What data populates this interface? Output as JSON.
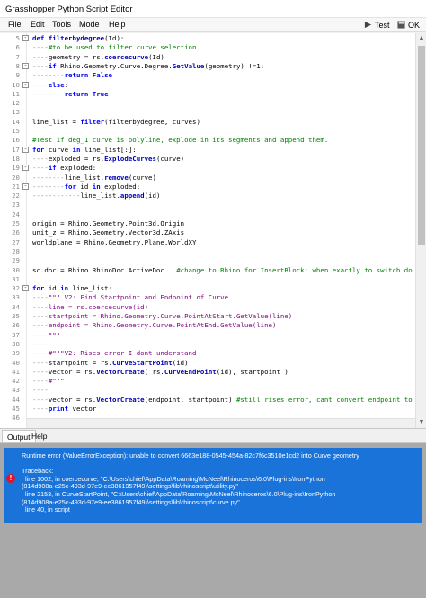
{
  "window": {
    "title": "Grasshopper Python Script Editor"
  },
  "menu": {
    "items": [
      "File",
      "Edit",
      "Tools",
      "Mode",
      "Help"
    ]
  },
  "toolbar": {
    "test_label": "Test",
    "ok_label": "OK"
  },
  "editor": {
    "lines": [
      {
        "n": "5",
        "fold": "-",
        "segs": [
          [
            "k",
            "def "
          ],
          [
            "f",
            "filterbydegree"
          ],
          [
            "p",
            "(Id):"
          ]
        ]
      },
      {
        "n": "6",
        "segs": [
          [
            "i",
            "----"
          ],
          [
            "c",
            "#to be used to filter curve selection."
          ]
        ]
      },
      {
        "n": "7",
        "segs": [
          [
            "i",
            "----"
          ],
          [
            "p",
            "geometry = rs."
          ],
          [
            "f",
            "coercecurve"
          ],
          [
            "p",
            "(Id)"
          ]
        ]
      },
      {
        "n": "8",
        "fold": "-",
        "segs": [
          [
            "i",
            "----"
          ],
          [
            "k",
            "if "
          ],
          [
            "p",
            "Rhino.Geometry.Curve.Degree."
          ],
          [
            "f",
            "GetValue"
          ],
          [
            "p",
            "(geometry) !=1:"
          ]
        ]
      },
      {
        "n": "9",
        "segs": [
          [
            "i",
            "--------"
          ],
          [
            "k",
            "return False"
          ]
        ]
      },
      {
        "n": "10",
        "fold": "-",
        "segs": [
          [
            "i",
            "----"
          ],
          [
            "k",
            "else"
          ],
          [
            "p",
            ":"
          ]
        ]
      },
      {
        "n": "11",
        "segs": [
          [
            "i",
            "--------"
          ],
          [
            "k",
            "return True"
          ]
        ]
      },
      {
        "n": "12",
        "segs": []
      },
      {
        "n": "13",
        "segs": []
      },
      {
        "n": "14",
        "segs": [
          [
            "p",
            "line_list = "
          ],
          [
            "k",
            "filter"
          ],
          [
            "p",
            "(filterbydegree, curves)"
          ]
        ]
      },
      {
        "n": "15",
        "segs": []
      },
      {
        "n": "16",
        "segs": [
          [
            "c",
            "#Test if deg_1 curve is polyline, explode in its segments and append them."
          ]
        ]
      },
      {
        "n": "17",
        "fold": "-",
        "segs": [
          [
            "k",
            "for "
          ],
          [
            "p",
            "curve "
          ],
          [
            "k",
            "in "
          ],
          [
            "p",
            "line_list[:]:"
          ]
        ]
      },
      {
        "n": "18",
        "segs": [
          [
            "i",
            "----"
          ],
          [
            "p",
            "exploded = rs."
          ],
          [
            "f",
            "ExplodeCurves"
          ],
          [
            "p",
            "(curve)"
          ]
        ]
      },
      {
        "n": "19",
        "fold": "-",
        "segs": [
          [
            "i",
            "----"
          ],
          [
            "k",
            "if "
          ],
          [
            "p",
            "exploded:"
          ]
        ]
      },
      {
        "n": "20",
        "segs": [
          [
            "i",
            "--------"
          ],
          [
            "p",
            "line_list."
          ],
          [
            "f",
            "remove"
          ],
          [
            "p",
            "(curve)"
          ]
        ]
      },
      {
        "n": "21",
        "fold": "-",
        "segs": [
          [
            "i",
            "--------"
          ],
          [
            "k",
            "for "
          ],
          [
            "p",
            "id "
          ],
          [
            "k",
            "in "
          ],
          [
            "p",
            "exploded:"
          ]
        ]
      },
      {
        "n": "22",
        "segs": [
          [
            "i",
            "------------"
          ],
          [
            "p",
            "line_list."
          ],
          [
            "f",
            "append"
          ],
          [
            "p",
            "(id)"
          ]
        ]
      },
      {
        "n": "23",
        "segs": []
      },
      {
        "n": "24",
        "segs": []
      },
      {
        "n": "25",
        "segs": [
          [
            "p",
            "origin = Rhino.Geometry.Point3d.Origin"
          ]
        ]
      },
      {
        "n": "26",
        "segs": [
          [
            "p",
            "unit_z = Rhino.Geometry.Vector3d.ZAxis"
          ]
        ]
      },
      {
        "n": "27",
        "segs": [
          [
            "p",
            "worldplane = Rhino.Geometry.Plane.WorldXY"
          ]
        ]
      },
      {
        "n": "28",
        "segs": []
      },
      {
        "n": "29",
        "segs": []
      },
      {
        "n": "30",
        "segs": [
          [
            "p",
            "sc.doc = Rhino.RhinoDoc.ActiveDoc   "
          ],
          [
            "c",
            "#change to Rhino for InsertBlock; when exactly to switch do"
          ]
        ]
      },
      {
        "n": "31",
        "segs": []
      },
      {
        "n": "32",
        "fold": "-",
        "segs": [
          [
            "k",
            "for "
          ],
          [
            "p",
            "id "
          ],
          [
            "k",
            "in "
          ],
          [
            "p",
            "line_list:"
          ]
        ]
      },
      {
        "n": "33",
        "segs": [
          [
            "i",
            "----"
          ],
          [
            "s",
            "\"\"\" V2: Find Startpoint and Endpoint of Curve"
          ]
        ]
      },
      {
        "n": "34",
        "segs": [
          [
            "i",
            "----"
          ],
          [
            "s",
            "line = rs.coercecurve(id)"
          ]
        ]
      },
      {
        "n": "35",
        "segs": [
          [
            "i",
            "----"
          ],
          [
            "s",
            "startpoint = Rhino.Geometry.Curve.PointAtStart.GetValue(line)"
          ]
        ]
      },
      {
        "n": "36",
        "segs": [
          [
            "i",
            "----"
          ],
          [
            "s",
            "endpoint = Rhino.Geometry.Curve.PointAtEnd.GetValue(line)"
          ]
        ]
      },
      {
        "n": "37",
        "segs": [
          [
            "i",
            "----"
          ],
          [
            "s",
            "\"\"\""
          ]
        ]
      },
      {
        "n": "38",
        "segs": [
          [
            "i",
            "----"
          ]
        ]
      },
      {
        "n": "39",
        "segs": [
          [
            "i",
            "----"
          ],
          [
            "s",
            "#\"\"\"V2: Rises error I dont understand"
          ]
        ]
      },
      {
        "n": "40",
        "segs": [
          [
            "i",
            "----"
          ],
          [
            "p",
            "startpoint = rs."
          ],
          [
            "f",
            "CurveStartPoint"
          ],
          [
            "p",
            "(id)"
          ]
        ]
      },
      {
        "n": "41",
        "segs": [
          [
            "i",
            "----"
          ],
          [
            "p",
            "vector = rs."
          ],
          [
            "f",
            "VectorCreate"
          ],
          [
            "p",
            "( rs."
          ],
          [
            "f",
            "CurveEndPoint"
          ],
          [
            "p",
            "(id), startpoint )"
          ]
        ]
      },
      {
        "n": "42",
        "segs": [
          [
            "i",
            "----"
          ],
          [
            "s",
            "#\"\"\""
          ]
        ]
      },
      {
        "n": "43",
        "segs": [
          [
            "i",
            "----"
          ]
        ]
      },
      {
        "n": "44",
        "segs": [
          [
            "i",
            "----"
          ],
          [
            "p",
            "vector = rs."
          ],
          [
            "f",
            "VectorCreate"
          ],
          [
            "p",
            "(endpoint, startpoint) "
          ],
          [
            "c",
            "#still rises error, cant convert endpoint to"
          ]
        ]
      },
      {
        "n": "45",
        "segs": [
          [
            "i",
            "----"
          ],
          [
            "k",
            "print "
          ],
          [
            "p",
            "vector"
          ]
        ]
      },
      {
        "n": "46",
        "segs": []
      }
    ]
  },
  "tabs": [
    "Output",
    "Help"
  ],
  "output": {
    "lines": [
      "Runtime error (ValueErrorException): unable to convert 6663e188-0545-454a-82c7f6c3510e1cd2 into Curve geometry",
      "",
      "Traceback:",
      "  line 1002, in coercecurve, \"C:\\Users\\chief\\AppData\\Roaming\\McNeel\\Rhinoceros\\6.0\\Plug-ins\\IronPython",
      "(814d908a-e25c-493d-97e9-ee3861957f49)\\settings\\lib\\rhinoscript\\utility.py\"",
      "  line 2153, in CurveStartPoint, \"C:\\Users\\chief\\AppData\\Roaming\\McNeel\\Rhinoceros\\6.0\\Plug-ins\\IronPython",
      "(814d908a-e25c-493d-97e9-ee3861957f49)\\settings\\lib\\rhinoscript\\curve.py\"",
      "  line 40, in script"
    ]
  }
}
